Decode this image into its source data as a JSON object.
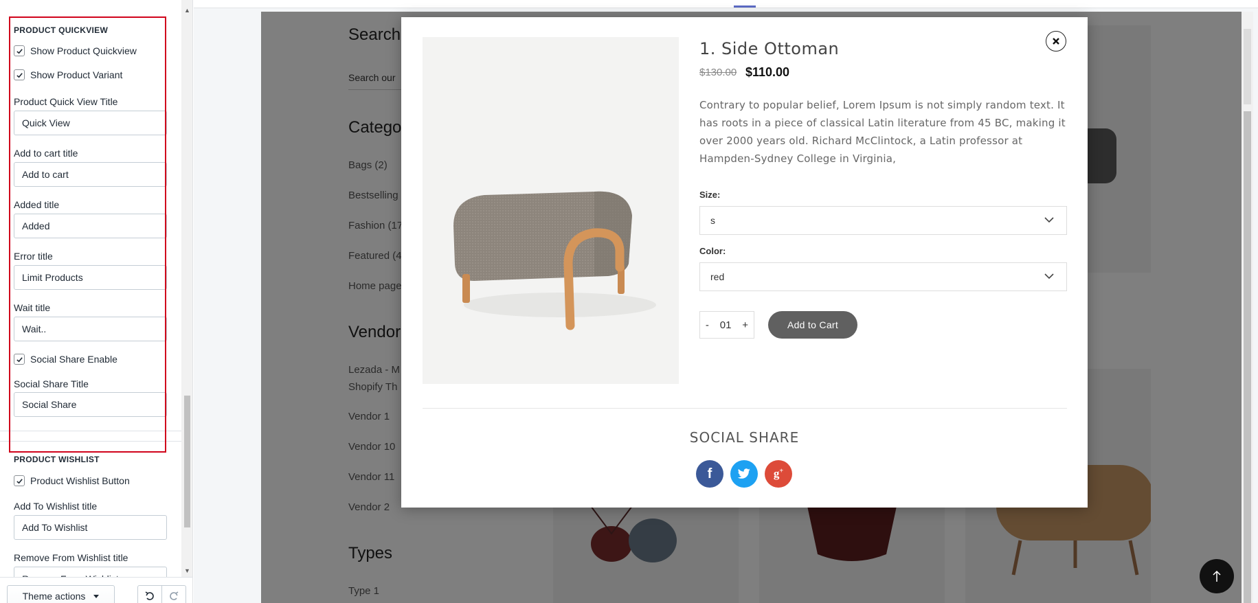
{
  "sidebar": {
    "quickview_section_title": "PRODUCT QUICKVIEW",
    "show_quickview_label": "Show Product Quickview",
    "show_variant_label": "Show Product Variant",
    "quickview_title_label": "Product Quick View Title",
    "quickview_title_value": "Quick View",
    "add_to_cart_label": "Add to cart title",
    "add_to_cart_value": "Add to cart",
    "added_label": "Added title",
    "added_value": "Added",
    "error_label": "Error title",
    "error_value": "Limit Products",
    "wait_label": "Wait title",
    "wait_value": "Wait..",
    "social_enable_label": "Social Share Enable",
    "social_title_label": "Social Share Title",
    "social_title_value": "Social Share",
    "wishlist_section_title": "PRODUCT WISHLIST",
    "wishlist_button_label": "Product Wishlist Button",
    "add_wishlist_label": "Add To Wishlist title",
    "add_wishlist_value": "Add To Wishlist",
    "remove_wishlist_label": "Remove From Wishlist title",
    "remove_wishlist_value": "Remove From Wishlist",
    "checkboxes_checked": [
      true,
      true,
      true,
      true
    ]
  },
  "footer": {
    "theme_actions_label": "Theme actions"
  },
  "page": {
    "search_heading": "Search",
    "search_placeholder": "Search our",
    "categories_heading": "Catego",
    "categories": [
      "Bags (2)",
      "Bestselling",
      "Fashion (17",
      "Featured (4",
      "Home page"
    ],
    "vendors_heading": "Vendor",
    "vendors": [
      "Lezada - M",
      "Shopify Th",
      "Vendor 1",
      "Vendor 10",
      "Vendor 11",
      "Vendor 2"
    ],
    "types_heading": "Types",
    "types": [
      "Type 1"
    ]
  },
  "modal": {
    "title": "1. Side Ottoman",
    "old_price": "$130.00",
    "new_price": "$110.00",
    "description": "Contrary to popular belief, Lorem Ipsum is not simply random text. It has roots in a piece of classical Latin literature from 45 BC, making it over 2000 years old. Richard McClintock, a Latin professor at Hampden-Sydney College in Virginia,",
    "size_label": "Size:",
    "size_value": "s",
    "color_label": "Color:",
    "color_value": "red",
    "qty_minus": "-",
    "qty_value": "01",
    "qty_plus": "+",
    "add_to_cart_button": "Add to Cart",
    "social_share_title": "SOCIAL SHARE",
    "social_icons": [
      {
        "name": "facebook",
        "glyph": "f",
        "color": "#3b5998"
      },
      {
        "name": "twitter",
        "glyph": "t",
        "color": "#1da1f2"
      },
      {
        "name": "google-plus",
        "glyph": "g+",
        "color": "#dd4b39"
      }
    ]
  },
  "colors": {
    "highlight_border": "#d0021b",
    "button_dark": "#606060",
    "accent_tab": "#5c6ac4"
  }
}
